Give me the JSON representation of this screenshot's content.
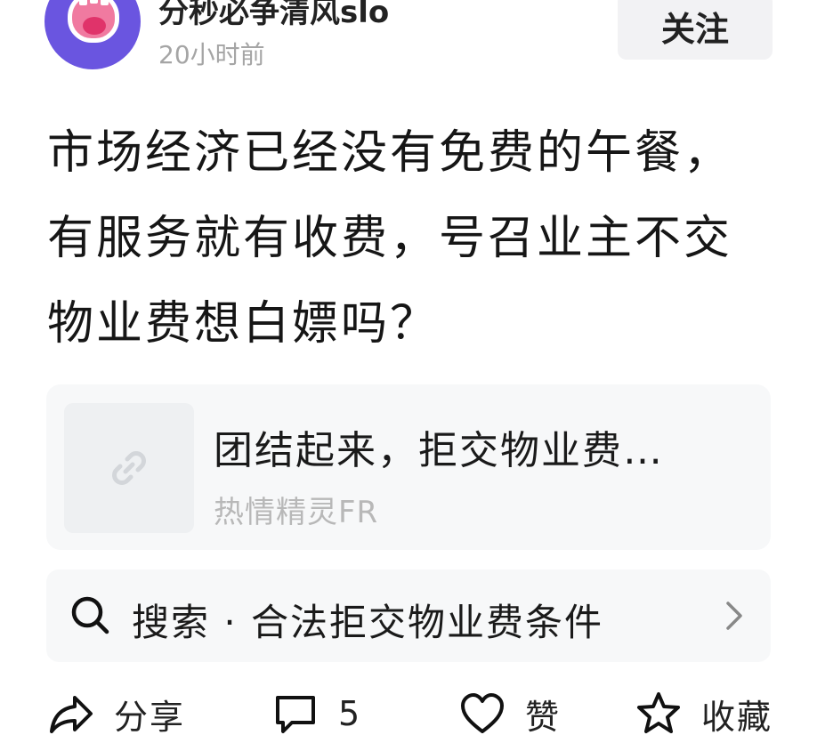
{
  "author": {
    "name": "分秒必争清风slo",
    "time": "20小时前"
  },
  "follow_label": "关注",
  "post": {
    "text": "市场经济已经没有免费的午餐，有服务就有收费，号召业主不交物业费想白嫖吗？"
  },
  "link_card": {
    "title": "团结起来，拒交物业费…",
    "author": "热情精灵FR",
    "thumb_icon": "link-icon"
  },
  "search": {
    "text": "搜索 · 合法拒交物业费条件",
    "icon": "search-icon"
  },
  "actions": {
    "share_label": "分享",
    "comment_count": "5",
    "like_label": "赞",
    "favorite_label": "收藏"
  },
  "colors": {
    "avatar_bg": "#6a55e0",
    "card_bg": "#f7f8f9",
    "muted_text": "#a5a5a5"
  }
}
